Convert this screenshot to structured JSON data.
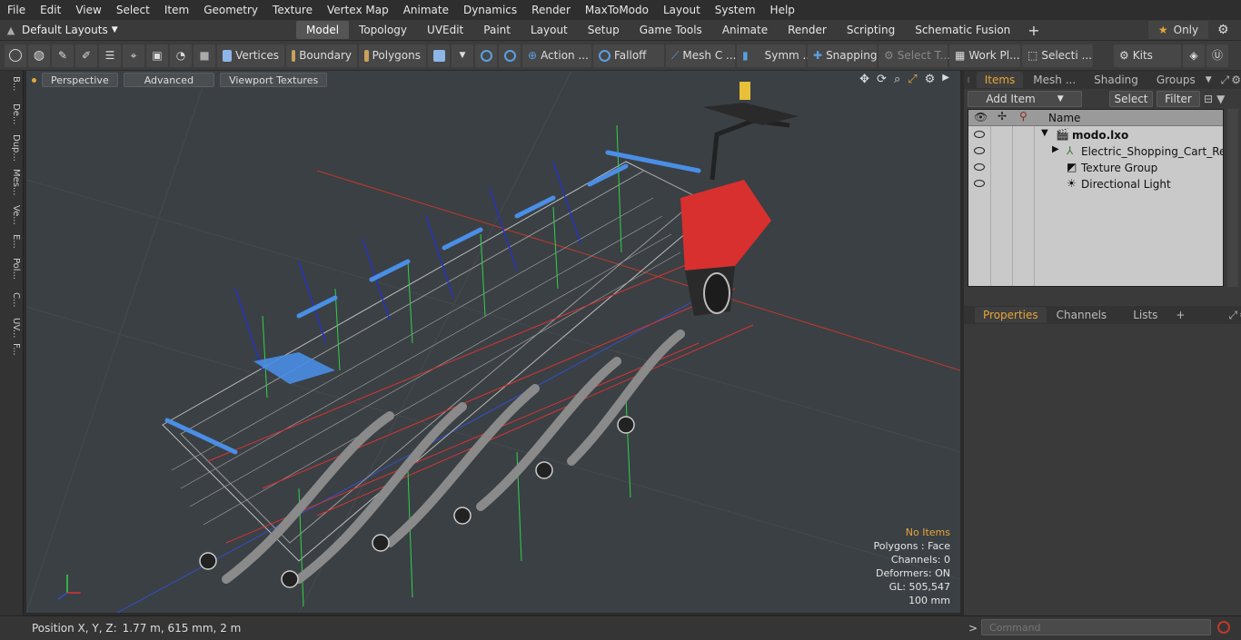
{
  "menu": [
    "File",
    "Edit",
    "View",
    "Select",
    "Item",
    "Geometry",
    "Texture",
    "Vertex Map",
    "Animate",
    "Dynamics",
    "Render",
    "MaxToModo",
    "Layout",
    "System",
    "Help"
  ],
  "layout": {
    "preset": "Default Layouts",
    "tabs": [
      "Model",
      "Topology",
      "UVEdit",
      "Paint",
      "Layout",
      "Setup",
      "Game Tools",
      "Animate",
      "Render",
      "Scripting",
      "Schematic Fusion"
    ],
    "active_tab": "Model",
    "only_label": "Only"
  },
  "toolbar": {
    "vertices": "Vertices",
    "boundary": "Boundary",
    "polygons": "Polygons",
    "action": "Action ...",
    "falloff": "Falloff",
    "mesh": "Mesh C ...",
    "symm": "Symm ...",
    "snapping": "Snapping",
    "select_t": "Select T...",
    "work_pl": "Work Pl...",
    "selecti": "Selecti ...",
    "kits": "Kits"
  },
  "left_tabs": [
    "B...",
    "De...",
    "Dup...",
    "Mes...",
    "Ve...",
    "E...",
    "Pol...",
    "C...",
    "UV...",
    "F..."
  ],
  "viewport": {
    "perspective": "Perspective",
    "advanced": "Advanced",
    "textures": "Viewport Textures",
    "info": {
      "no_items": "No Items",
      "polygons": "Polygons : Face",
      "channels": "Channels: 0",
      "deformers": "Deformers: ON",
      "gl": "GL: 505,547",
      "scale": "100 mm"
    },
    "colors": {
      "accent": "#e8a53a",
      "cart_red": "#d8302f",
      "handle_blue": "#4a8ee6"
    }
  },
  "items_panel": {
    "tabs": [
      "Items",
      "Mesh ...",
      "Shading",
      "Groups"
    ],
    "add_item": "Add Item",
    "select": "Select",
    "filter": "Filter",
    "column_name": "Name",
    "rows": [
      {
        "label": "modo.lxo",
        "bold": true
      },
      {
        "label": "Electric_Shopping_Cart_Retri ..."
      },
      {
        "label": "Texture Group"
      },
      {
        "label": "Directional Light"
      }
    ]
  },
  "properties_panel": {
    "tabs": [
      "Properties",
      "Channels",
      "Lists"
    ]
  },
  "status": {
    "position_label": "Position X, Y, Z:",
    "position_value": "1.77 m, 615 mm, 2 m",
    "command_placeholder": "Command"
  }
}
